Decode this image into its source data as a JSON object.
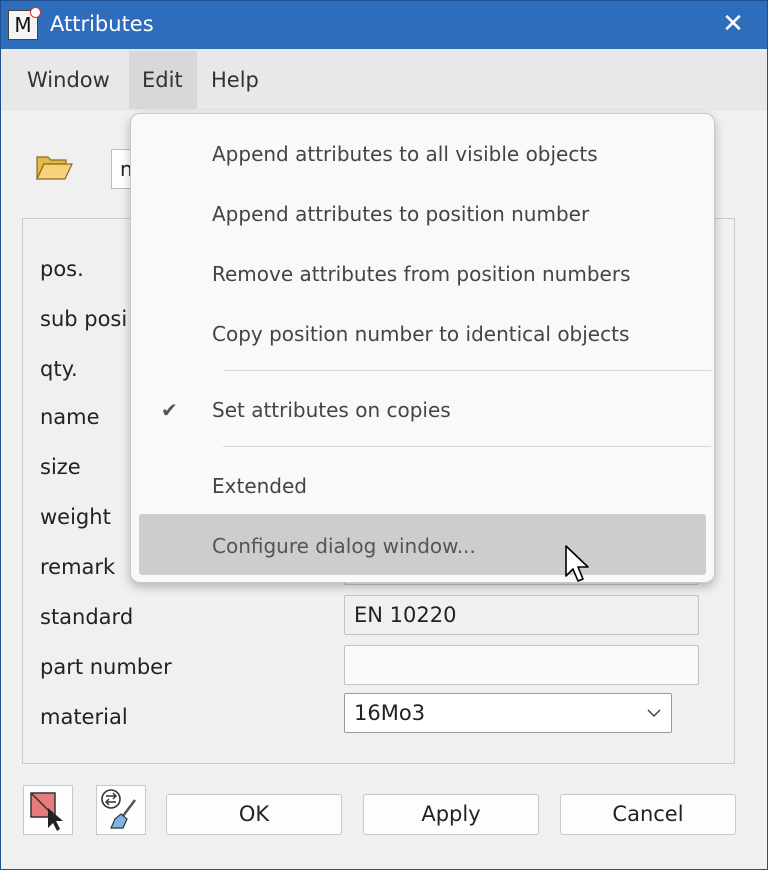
{
  "window": {
    "title": "Attributes",
    "app_icon_letter": "M"
  },
  "menubar": {
    "items": [
      "Window",
      "Edit",
      "Help"
    ]
  },
  "toolbar": {
    "name_value": "n"
  },
  "fields": {
    "pos": "pos.",
    "sub_position": "sub posi",
    "qty": "qty.",
    "name": "name",
    "size": "size",
    "weight": "weight",
    "remark": "remark",
    "standard": "standard",
    "standard_value": "EN 10220",
    "part_number": "part number",
    "part_number_value": "",
    "material": "material",
    "material_value": "16Mo3"
  },
  "buttons": {
    "ok": "OK",
    "apply": "Apply",
    "cancel": "Cancel"
  },
  "edit_menu": {
    "items": [
      "Append attributes to all visible objects",
      "Append attributes to position number",
      "Remove attributes from position numbers",
      "Copy position number to identical objects",
      "Set attributes on copies",
      "Extended",
      "Configure dialog window..."
    ],
    "checked_item": "Set attributes on copies",
    "highlighted_item": "Configure dialog window..."
  },
  "colors": {
    "titlebar": "#2e6dbc",
    "menu_hover": "#cdcdcd"
  },
  "icons": [
    "app-icon",
    "close-icon",
    "folder-open-icon",
    "checkmark-icon",
    "chevron-down-icon",
    "select-object-icon",
    "attribute-brush-icon",
    "mouse-cursor-icon"
  ]
}
